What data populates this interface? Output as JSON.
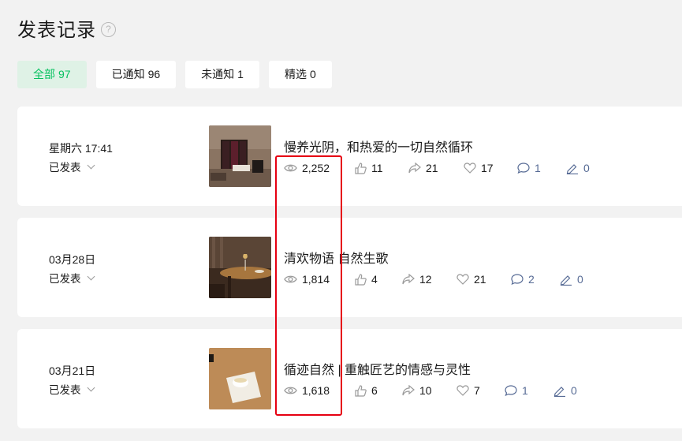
{
  "page": {
    "title": "发表记录",
    "help_icon": "?"
  },
  "tabs": [
    {
      "label": "全部",
      "count": "97",
      "active": true
    },
    {
      "label": "已通知",
      "count": "96",
      "active": false
    },
    {
      "label": "未通知",
      "count": "1",
      "active": false
    },
    {
      "label": "精选",
      "count": "0",
      "active": false
    }
  ],
  "articles": [
    {
      "date": "星期六 17:41",
      "status": "已发表",
      "title": "慢养光阴，和热爱的一切自然循环",
      "thumb_icon": "bedroom-photo",
      "stats": {
        "reads": "2,252",
        "likes": "11",
        "shares": "21",
        "favorites": "17",
        "comments": "1",
        "notes": "0"
      }
    },
    {
      "date": "03月28日",
      "status": "已发表",
      "title": "清欢物语 自然生歌",
      "thumb_icon": "dining-table-photo",
      "stats": {
        "reads": "1,814",
        "likes": "4",
        "shares": "12",
        "favorites": "21",
        "comments": "2",
        "notes": "0"
      }
    },
    {
      "date": "03月21日",
      "status": "已发表",
      "title": "循迹自然 | 重触匠艺的情感与灵性",
      "thumb_icon": "teacup-photo",
      "stats": {
        "reads": "1,618",
        "likes": "6",
        "shares": "10",
        "favorites": "7",
        "comments": "1",
        "notes": "0"
      }
    }
  ],
  "colors": {
    "accent": "#07c160",
    "highlight": "#e60012",
    "link": "#576b95"
  }
}
